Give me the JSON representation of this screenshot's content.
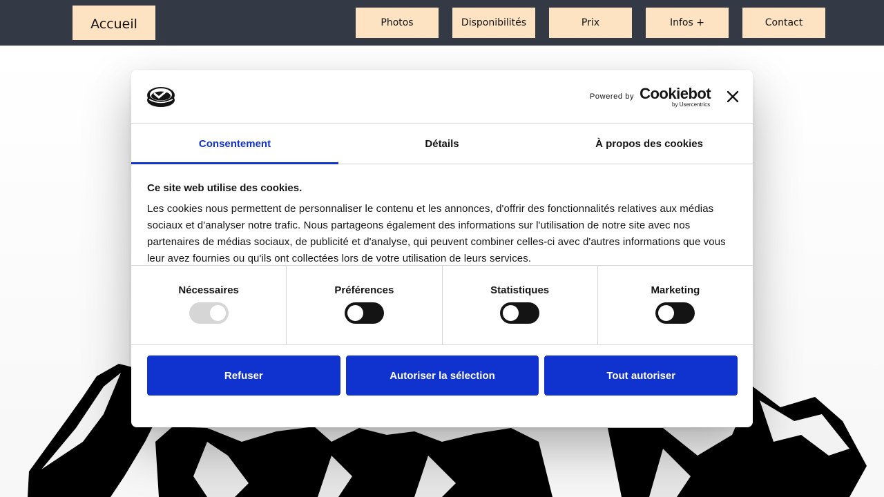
{
  "nav": {
    "home": "Accueil",
    "items": [
      {
        "label": "Photos"
      },
      {
        "label": "Disponibilités"
      },
      {
        "label": "Prix"
      },
      {
        "label": "Infos +"
      },
      {
        "label": "Contact"
      }
    ]
  },
  "cookie_dialog": {
    "logo_icon": "cookie-check-icon",
    "powered_by": "Powered by",
    "brand": "Cookiebot",
    "brand_sub": "by Usercentrics",
    "close_icon": "close-icon",
    "tabs": [
      {
        "label": "Consentement",
        "active": true
      },
      {
        "label": "Détails",
        "active": false
      },
      {
        "label": "À propos des cookies",
        "active": false
      }
    ],
    "title": "Ce site web utilise des cookies.",
    "description": "Les cookies nous permettent de personnaliser le contenu et les annonces, d'offrir des fonctionnalités relatives aux médias sociaux et d'analyser notre trafic. Nous partageons également des informations sur l'utilisation de notre site avec nos partenaires de médias sociaux, de publicité et d'analyse, qui peuvent combiner celles-ci avec d'autres informations que vous leur avez fournies ou qu'ils ont collectées lors de votre utilisation de leurs services.",
    "categories": [
      {
        "label": "Nécessaires",
        "state": "on-disabled"
      },
      {
        "label": "Préférences",
        "state": "off"
      },
      {
        "label": "Statistiques",
        "state": "off"
      },
      {
        "label": "Marketing",
        "state": "off"
      }
    ],
    "buttons": {
      "decline": "Refuser",
      "allow_selection": "Autoriser la sélection",
      "allow_all": "Tout autoriser"
    }
  },
  "colors": {
    "topbar": "#343a45",
    "nav_button": "#fde3c2",
    "accent": "#1032cf",
    "toggle_off": "#141414",
    "toggle_disabled": "#d6d6d6"
  }
}
